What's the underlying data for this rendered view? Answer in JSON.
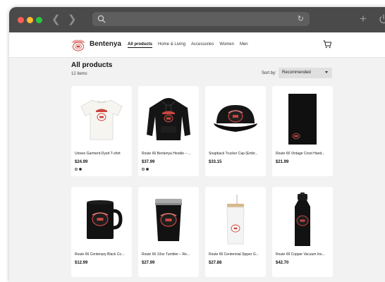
{
  "browser": {
    "url_value": "",
    "url_placeholder": "",
    "icons": [
      "back-arrow-icon",
      "forward-arrow-icon",
      "search-icon",
      "reload-icon",
      "new-tab-plus-icon",
      "power-icon"
    ]
  },
  "header": {
    "brand": "Bentenya",
    "nav": [
      "All products",
      "Home & Living",
      "Accessories",
      "Women",
      "Men"
    ],
    "active_nav": "All products"
  },
  "catalog": {
    "title": "All products",
    "count": "12 items",
    "sort_label": "Sort by:",
    "sort_value": "Recommended"
  },
  "products": [
    {
      "name": "Unisex Garment-Dyed T-shirt",
      "price": "$24.99",
      "swatches": [
        "white",
        "black"
      ],
      "image": "white-tshirt"
    },
    {
      "name": "Route 66 Bentenya Hoodie – ...",
      "price": "$37.99",
      "swatches": [
        "white",
        "black"
      ],
      "image": "black-hoodie"
    },
    {
      "name": "Snapback Trucker Cap (Embr...",
      "price": "$33.15",
      "swatches": [],
      "image": "black-cap"
    },
    {
      "name": "Route 66 Vintage Crest Hand...",
      "price": "$21.99",
      "swatches": [],
      "image": "black-towel"
    },
    {
      "name": "Route 66 Centenary Black Co...",
      "price": "$12.99",
      "swatches": [],
      "image": "black-mug"
    },
    {
      "name": "Route 66 10oz Tumbler – Re...",
      "price": "$27.99",
      "swatches": [],
      "image": "black-tumbler"
    },
    {
      "name": "Route 66 Centennial Sipper G...",
      "price": "$27.88",
      "swatches": [],
      "image": "glass-sipper"
    },
    {
      "name": "Route 66 Copper Vacuum Ins...",
      "price": "$42.70",
      "swatches": [],
      "image": "black-bottle"
    }
  ]
}
